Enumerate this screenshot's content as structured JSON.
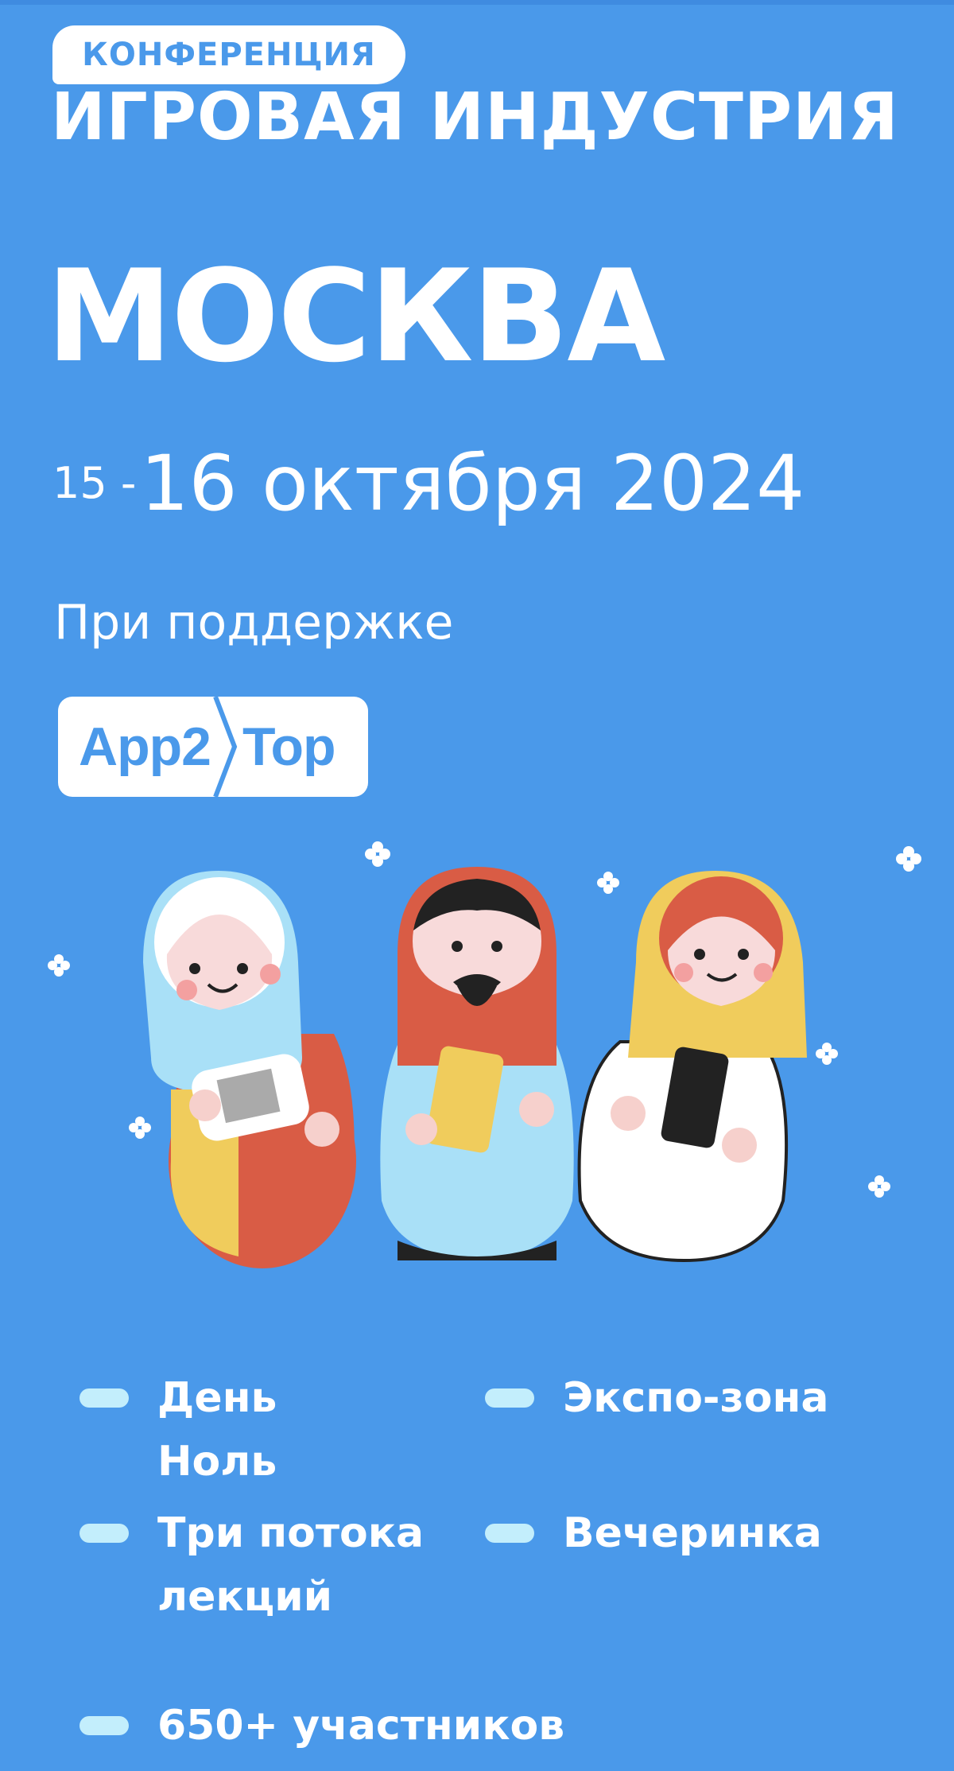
{
  "header": {
    "badge": "КОНФЕРЕНЦИЯ",
    "title": "ИГРОВАЯ ИНДУСТРИЯ"
  },
  "event": {
    "city": "МОСКВА",
    "date_start": "15 -",
    "date_rest": "16 октября 2024"
  },
  "support": {
    "label": "При поддержке",
    "sponsor_left": "App2",
    "sponsor_right": "Top"
  },
  "features": [
    {
      "label": "День\nНоль"
    },
    {
      "label": "Экспо-зона"
    },
    {
      "label": "Три потока\nлекций"
    },
    {
      "label": "Вечеринка"
    },
    {
      "label": "650+ участников"
    }
  ],
  "colors": {
    "background": "#4a99ea",
    "pill": "#c3eefc",
    "doll_blue": "#a9e0f7",
    "doll_red": "#d95c45",
    "doll_yellow": "#f0cc5c"
  }
}
